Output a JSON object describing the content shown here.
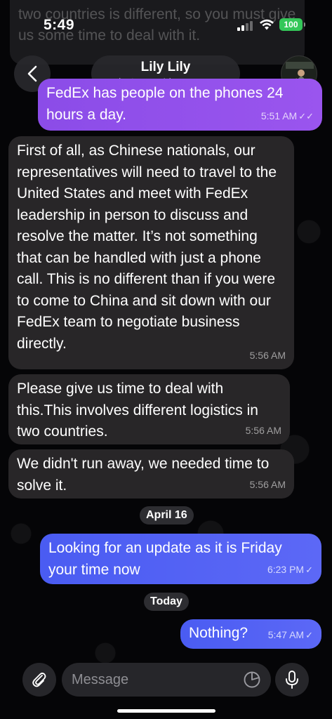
{
  "status_bar": {
    "time": "5:49",
    "battery": "100",
    "battery_color": "#34c759"
  },
  "ghost_message": {
    "text": "two countries is different, so you must give us some time to deal with it."
  },
  "header": {
    "contact_name": "Lily Lily",
    "last_seen": "last seen 4 hours ago",
    "back_icon": "chevron-left-icon",
    "avatar": "contact-avatar"
  },
  "messages": [
    {
      "direction": "outgoing",
      "text": "FedEx has people on the phones 24 hours a day.",
      "time": "5:51 AM",
      "status": "✓✓",
      "color": "#9a55ee"
    },
    {
      "direction": "incoming",
      "text": "First of all, as Chinese nationals, our representatives will need to travel to the United States and meet with FedEx leadership in person to discuss and resolve the matter. It’s not something that can be handled with just a phone call. This is no different than if you were to come to China and sit down with our FedEx team to negotiate business directly.",
      "time": "5:56 AM"
    },
    {
      "direction": "incoming",
      "text": "Please give us time to deal with this.This involves different logistics in two countries.",
      "time": "5:56 AM"
    },
    {
      "direction": "incoming",
      "text": "We didn't run away, we needed time to solve it.",
      "time": "5:56 AM"
    },
    {
      "direction": "outgoing",
      "text": "Looking for an update as it is Friday your time now",
      "time": "6:23 PM",
      "status": "✓",
      "color": "#5663f4"
    },
    {
      "direction": "outgoing",
      "text": "Nothing?",
      "time": "5:47 AM",
      "status": "✓",
      "color": "#5663f4"
    }
  ],
  "date_separators": [
    "April 16",
    "Today"
  ],
  "composer": {
    "placeholder": "Message",
    "attach_icon": "paperclip-icon",
    "sticker_icon": "sticker-icon",
    "mic_icon": "microphone-icon"
  }
}
